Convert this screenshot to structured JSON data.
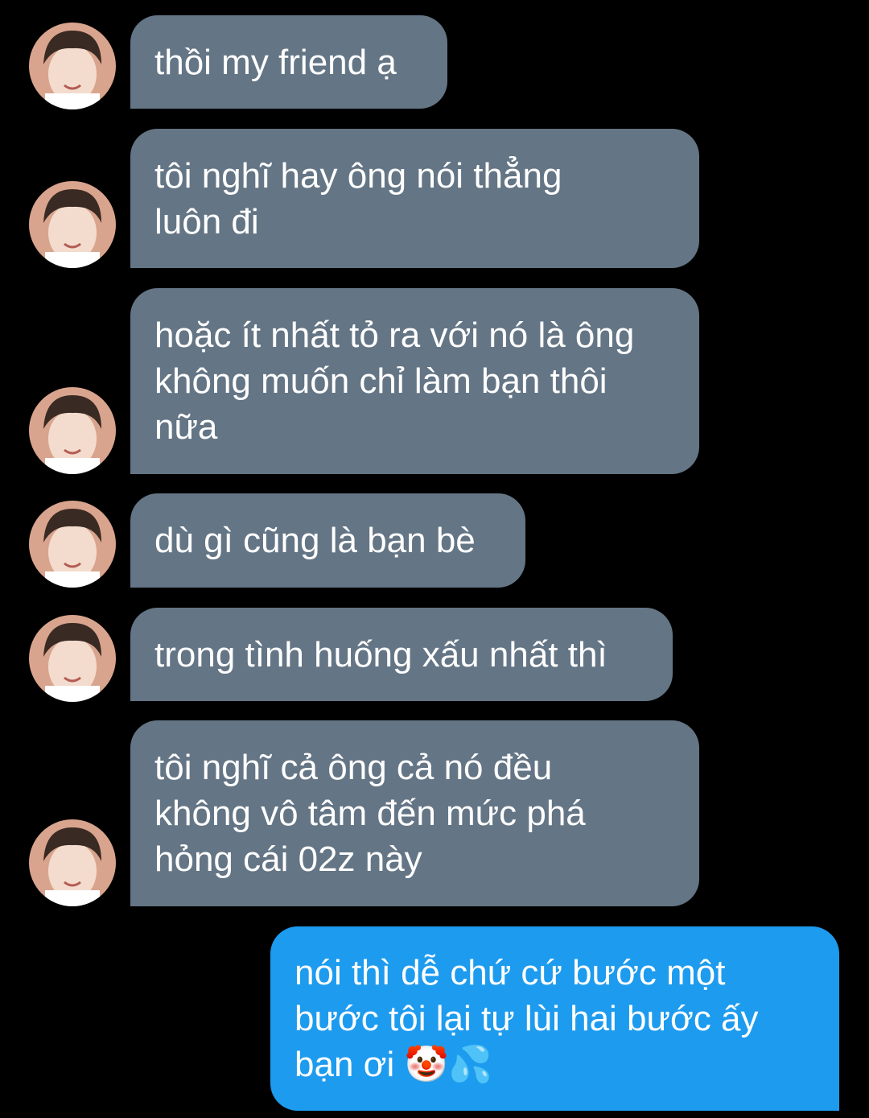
{
  "conversation": {
    "incoming_avatar_icon": "user-photo-avatar-icon",
    "colors": {
      "background": "#000000",
      "incoming_bubble": "#647585",
      "outgoing_bubble": "#1d9bef",
      "text": "#ffffff"
    },
    "messages": [
      {
        "sender": "other",
        "lines": [
          "thồi my friend ạ"
        ]
      },
      {
        "sender": "other",
        "lines": [
          "tôi nghĩ hay ông nói thẳng",
          "luôn đi"
        ]
      },
      {
        "sender": "other",
        "lines": [
          "hoặc ít nhất tỏ ra với nó là ông",
          "không muốn chỉ làm bạn thôi",
          "nữa"
        ]
      },
      {
        "sender": "other",
        "lines": [
          "dù gì cũng là bạn bè"
        ]
      },
      {
        "sender": "other",
        "lines": [
          "trong tình huống xấu nhất thì"
        ]
      },
      {
        "sender": "other",
        "lines": [
          "tôi nghĩ cả ông cả nó đều",
          "không vô tâm đến mức phá",
          "hỏng cái 02z này"
        ]
      },
      {
        "sender": "me",
        "lines": [
          "nói thì dễ chứ cứ bước một",
          "bước tôi lại tự lùi hai bước ấy",
          "bạn ơi 🤡💦"
        ]
      }
    ]
  }
}
